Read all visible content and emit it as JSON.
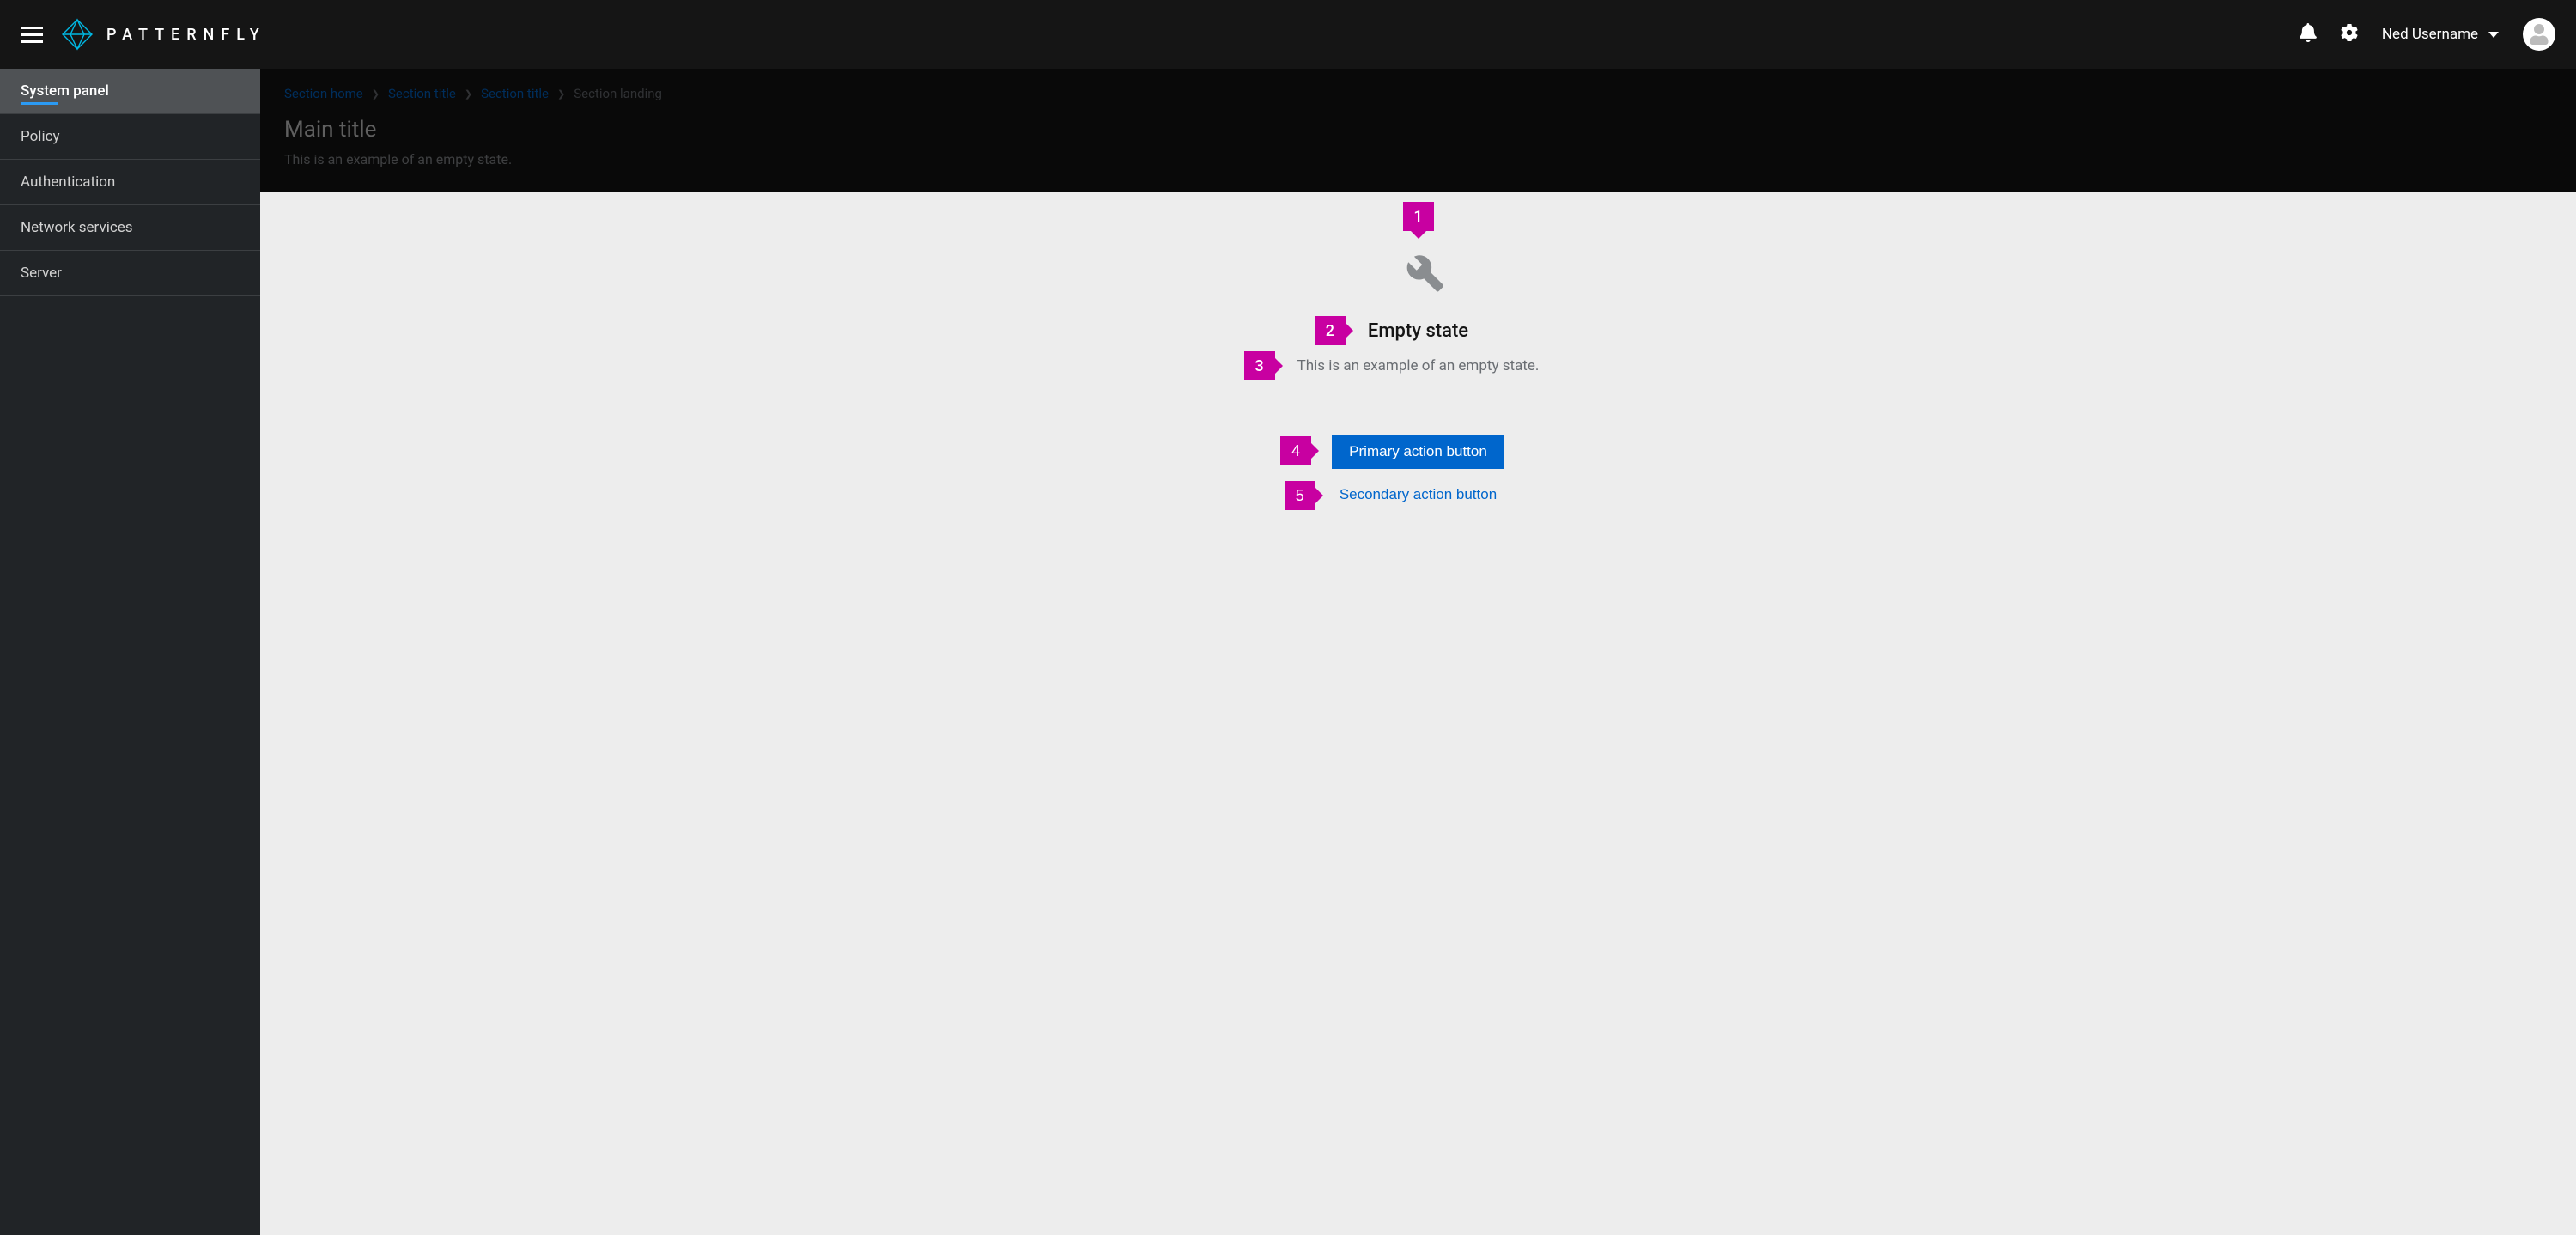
{
  "brand": {
    "name": "PATTERNFLY"
  },
  "header": {
    "username": "Ned Username"
  },
  "sidebar": {
    "items": [
      {
        "label": "System panel",
        "active": true
      },
      {
        "label": "Policy"
      },
      {
        "label": "Authentication"
      },
      {
        "label": "Network services"
      },
      {
        "label": "Server"
      }
    ]
  },
  "breadcrumb": {
    "items": [
      {
        "label": "Section home",
        "link": true
      },
      {
        "label": "Section title",
        "link": true
      },
      {
        "label": "Section title",
        "link": true
      },
      {
        "label": "Section landing",
        "link": false
      }
    ]
  },
  "page": {
    "title": "Main title",
    "description": "This is an example of an empty state."
  },
  "empty_state": {
    "icon": "wrench-icon",
    "title": "Empty state",
    "body": "This is an example of an empty state.",
    "primary_label": "Primary action button",
    "secondary_label": "Secondary action button"
  },
  "callouts": {
    "c1": "1",
    "c2": "2",
    "c3": "3",
    "c4": "4",
    "c5": "5"
  },
  "colors": {
    "accent": "#0066cc",
    "callout": "#c800a1",
    "brand_icon": "#00b9e4"
  }
}
